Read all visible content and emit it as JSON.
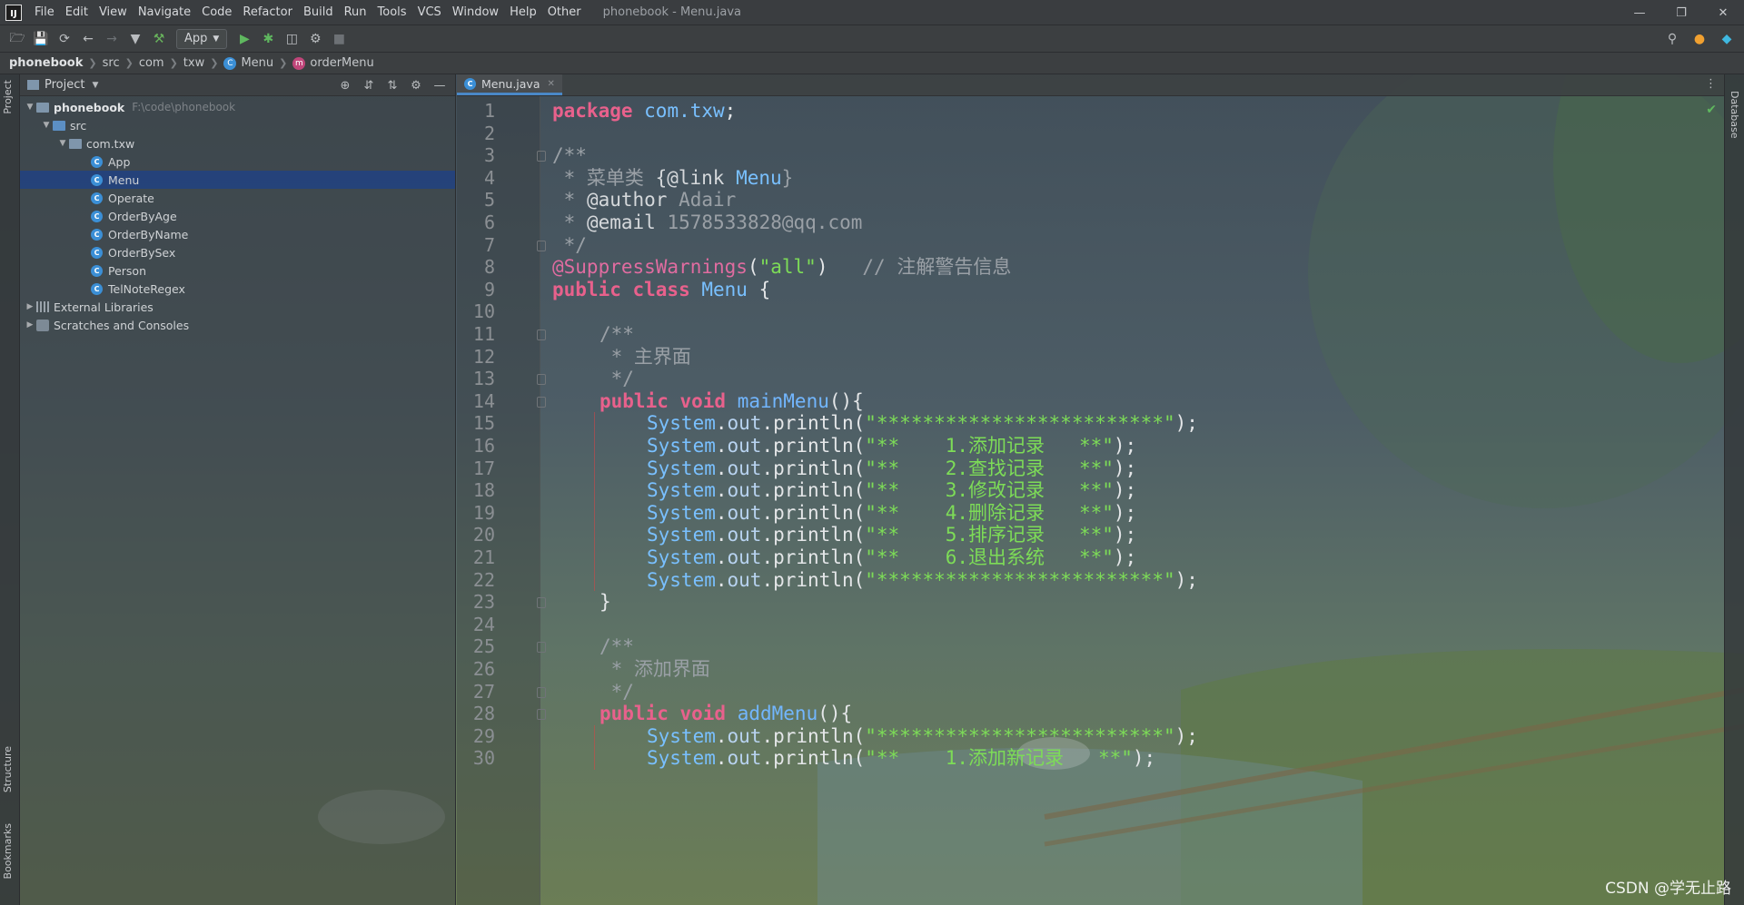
{
  "menubar": {
    "logo": "IJ",
    "items": [
      "File",
      "Edit",
      "View",
      "Navigate",
      "Code",
      "Refactor",
      "Build",
      "Run",
      "Tools",
      "VCS",
      "Window",
      "Help",
      "Other"
    ],
    "title": "phonebook - Menu.java",
    "window_controls": {
      "minimize": "—",
      "restore": "❐",
      "close": "✕"
    }
  },
  "toolbar": {
    "run_config": "App"
  },
  "breadcrumb": {
    "items": [
      "phonebook",
      "src",
      "com",
      "txw",
      "Menu",
      "orderMenu"
    ]
  },
  "tool_strips": {
    "left_top": "Project",
    "left_structure": "Structure",
    "left_bookmarks": "Bookmarks",
    "right": "Database"
  },
  "project_panel": {
    "title": "Project",
    "tree": [
      {
        "label": "phonebook",
        "hint": "F:\\code\\phonebook",
        "type": "module",
        "level": 0,
        "expanded": true
      },
      {
        "label": "src",
        "type": "folder",
        "level": 1,
        "expanded": true
      },
      {
        "label": "com.txw",
        "type": "package",
        "level": 2,
        "expanded": true
      },
      {
        "label": "App",
        "type": "class",
        "level": 3
      },
      {
        "label": "Menu",
        "type": "class",
        "level": 3,
        "selected": true
      },
      {
        "label": "Operate",
        "type": "class",
        "level": 3
      },
      {
        "label": "OrderByAge",
        "type": "class",
        "level": 3
      },
      {
        "label": "OrderByName",
        "type": "class",
        "level": 3
      },
      {
        "label": "OrderBySex",
        "type": "class",
        "level": 3
      },
      {
        "label": "Person",
        "type": "class",
        "level": 3
      },
      {
        "label": "TelNoteRegex",
        "type": "class",
        "level": 3
      },
      {
        "label": "External Libraries",
        "type": "library",
        "level": 0,
        "expanded": false
      },
      {
        "label": "Scratches and Consoles",
        "type": "scratch",
        "level": 0,
        "expanded": false
      }
    ]
  },
  "editor": {
    "tab": "Menu.java",
    "line_numbers": [
      "1",
      "2",
      "3",
      "4",
      "5",
      "6",
      "7",
      "8",
      "9",
      "10",
      "11",
      "12",
      "13",
      "14",
      "15",
      "16",
      "17",
      "18",
      "19",
      "20",
      "21",
      "22",
      "23",
      "24",
      "25",
      "26",
      "27",
      "28",
      "29",
      "30"
    ],
    "lines": [
      {
        "indent": 0,
        "tokens": [
          [
            "kw",
            "package "
          ],
          [
            "pkg",
            "com.txw"
          ],
          [
            "plain",
            ";"
          ]
        ]
      },
      {
        "indent": 0,
        "tokens": []
      },
      {
        "indent": 0,
        "tokens": [
          [
            "cmt",
            "/**"
          ]
        ]
      },
      {
        "indent": 0,
        "tokens": [
          [
            "cmt",
            " * 菜单类 "
          ],
          [
            "cmt-tag",
            "{@link "
          ],
          [
            "cmt-link",
            "Menu"
          ],
          [
            "cmt",
            "}"
          ]
        ]
      },
      {
        "indent": 0,
        "tokens": [
          [
            "cmt",
            " * "
          ],
          [
            "cmt-tag",
            "@author"
          ],
          [
            "cmt",
            " Adair"
          ]
        ]
      },
      {
        "indent": 0,
        "tokens": [
          [
            "cmt",
            " * "
          ],
          [
            "cmt-tag",
            "@email"
          ],
          [
            "cmt",
            " 1578533828@qq.com"
          ]
        ]
      },
      {
        "indent": 0,
        "tokens": [
          [
            "cmt",
            " */"
          ]
        ]
      },
      {
        "indent": 0,
        "tokens": [
          [
            "ann",
            "@SuppressWarnings"
          ],
          [
            "plain",
            "("
          ],
          [
            "str",
            "\"all\""
          ],
          [
            "plain",
            ")   "
          ],
          [
            "cmt",
            "// 注解警告信息"
          ]
        ]
      },
      {
        "indent": 0,
        "tokens": [
          [
            "kw",
            "public class "
          ],
          [
            "cls",
            "Menu"
          ],
          [
            "plain",
            " {"
          ]
        ]
      },
      {
        "indent": 0,
        "tokens": []
      },
      {
        "indent": 1,
        "tokens": [
          [
            "cmt",
            "/**"
          ]
        ]
      },
      {
        "indent": 1,
        "tokens": [
          [
            "cmt",
            " * 主界面"
          ]
        ]
      },
      {
        "indent": 1,
        "tokens": [
          [
            "cmt",
            " */"
          ]
        ]
      },
      {
        "indent": 1,
        "tokens": [
          [
            "kw",
            "public void "
          ],
          [
            "method",
            "mainMenu"
          ],
          [
            "plain",
            "(){"
          ]
        ]
      },
      {
        "indent": 2,
        "tokens": [
          [
            "cls",
            "System"
          ],
          [
            "plain",
            "."
          ],
          [
            "field",
            "out"
          ],
          [
            "plain",
            ".println("
          ],
          [
            "str",
            "\"*************************\""
          ],
          [
            "plain",
            ");"
          ]
        ]
      },
      {
        "indent": 2,
        "tokens": [
          [
            "cls",
            "System"
          ],
          [
            "plain",
            "."
          ],
          [
            "field",
            "out"
          ],
          [
            "plain",
            ".println("
          ],
          [
            "str",
            "\"**    1.添加记录   **\""
          ],
          [
            "plain",
            ");"
          ]
        ]
      },
      {
        "indent": 2,
        "tokens": [
          [
            "cls",
            "System"
          ],
          [
            "plain",
            "."
          ],
          [
            "field",
            "out"
          ],
          [
            "plain",
            ".println("
          ],
          [
            "str",
            "\"**    2.查找记录   **\""
          ],
          [
            "plain",
            ");"
          ]
        ]
      },
      {
        "indent": 2,
        "tokens": [
          [
            "cls",
            "System"
          ],
          [
            "plain",
            "."
          ],
          [
            "field",
            "out"
          ],
          [
            "plain",
            ".println("
          ],
          [
            "str",
            "\"**    3.修改记录   **\""
          ],
          [
            "plain",
            ");"
          ]
        ]
      },
      {
        "indent": 2,
        "tokens": [
          [
            "cls",
            "System"
          ],
          [
            "plain",
            "."
          ],
          [
            "field",
            "out"
          ],
          [
            "plain",
            ".println("
          ],
          [
            "str",
            "\"**    4.删除记录   **\""
          ],
          [
            "plain",
            ");"
          ]
        ]
      },
      {
        "indent": 2,
        "tokens": [
          [
            "cls",
            "System"
          ],
          [
            "plain",
            "."
          ],
          [
            "field",
            "out"
          ],
          [
            "plain",
            ".println("
          ],
          [
            "str",
            "\"**    5.排序记录   **\""
          ],
          [
            "plain",
            ");"
          ]
        ]
      },
      {
        "indent": 2,
        "tokens": [
          [
            "cls",
            "System"
          ],
          [
            "plain",
            "."
          ],
          [
            "field",
            "out"
          ],
          [
            "plain",
            ".println("
          ],
          [
            "str",
            "\"**    6.退出系统   **\""
          ],
          [
            "plain",
            ");"
          ]
        ]
      },
      {
        "indent": 2,
        "tokens": [
          [
            "cls",
            "System"
          ],
          [
            "plain",
            "."
          ],
          [
            "field",
            "out"
          ],
          [
            "plain",
            ".println("
          ],
          [
            "str",
            "\"*************************\""
          ],
          [
            "plain",
            ");"
          ]
        ]
      },
      {
        "indent": 1,
        "tokens": [
          [
            "plain",
            "}"
          ]
        ]
      },
      {
        "indent": 0,
        "tokens": []
      },
      {
        "indent": 1,
        "tokens": [
          [
            "cmt",
            "/**"
          ]
        ]
      },
      {
        "indent": 1,
        "tokens": [
          [
            "cmt",
            " * 添加界面"
          ]
        ]
      },
      {
        "indent": 1,
        "tokens": [
          [
            "cmt",
            " */"
          ]
        ]
      },
      {
        "indent": 1,
        "tokens": [
          [
            "kw",
            "public void "
          ],
          [
            "method",
            "addMenu"
          ],
          [
            "plain",
            "(){"
          ]
        ]
      },
      {
        "indent": 2,
        "tokens": [
          [
            "cls",
            "System"
          ],
          [
            "plain",
            "."
          ],
          [
            "field",
            "out"
          ],
          [
            "plain",
            ".println("
          ],
          [
            "str",
            "\"*************************\""
          ],
          [
            "plain",
            ");"
          ]
        ]
      },
      {
        "indent": 2,
        "tokens": [
          [
            "cls",
            "System"
          ],
          [
            "plain",
            "."
          ],
          [
            "field",
            "out"
          ],
          [
            "plain",
            ".println("
          ],
          [
            "str",
            "\"**    1.添加新记录   **\""
          ],
          [
            "plain",
            ");"
          ]
        ]
      }
    ]
  },
  "watermark": "CSDN @学无止路",
  "colors": {
    "keyword": "#e8618c",
    "string": "#7ddc57",
    "class": "#79c0ff",
    "comment": "#9aa0a6",
    "selection": "#214283",
    "tab_underline": "#4a88c7"
  }
}
